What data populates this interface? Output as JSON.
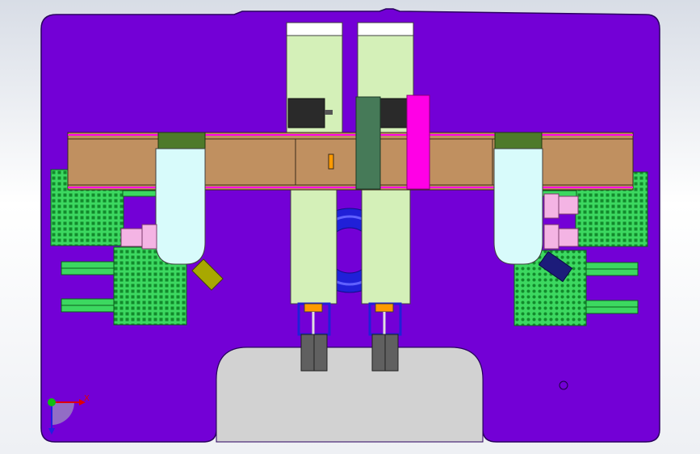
{
  "viewport": {
    "background_top": "#d8dde6",
    "background_bottom": "#ffffff"
  },
  "colors": {
    "base_plate": "#7300d6",
    "plate_edge": "#2a0060",
    "cutout": "#d2d2d2",
    "rail": "#c09060",
    "rail_edge": "#3a2a1a",
    "magenta": "#ff00e6",
    "pink_cylinder": "#f4b4e4",
    "cyan_gripper": "#d8fbfb",
    "green_mesh": "#3cd860",
    "green_mesh_dark": "#128a2c",
    "light_green_block": "#d4f0b8",
    "motor_dark": "#2a2a2a",
    "dark_green_clamp": "#467a58",
    "olive_cap": "#4e7a2a",
    "blue_ring": "#2020d8",
    "orange_tag": "#ff9a00",
    "yellow_green": "#a8a800"
  },
  "triad": {
    "x_label": "X",
    "y_label": "Y",
    "z_label": "Z"
  }
}
